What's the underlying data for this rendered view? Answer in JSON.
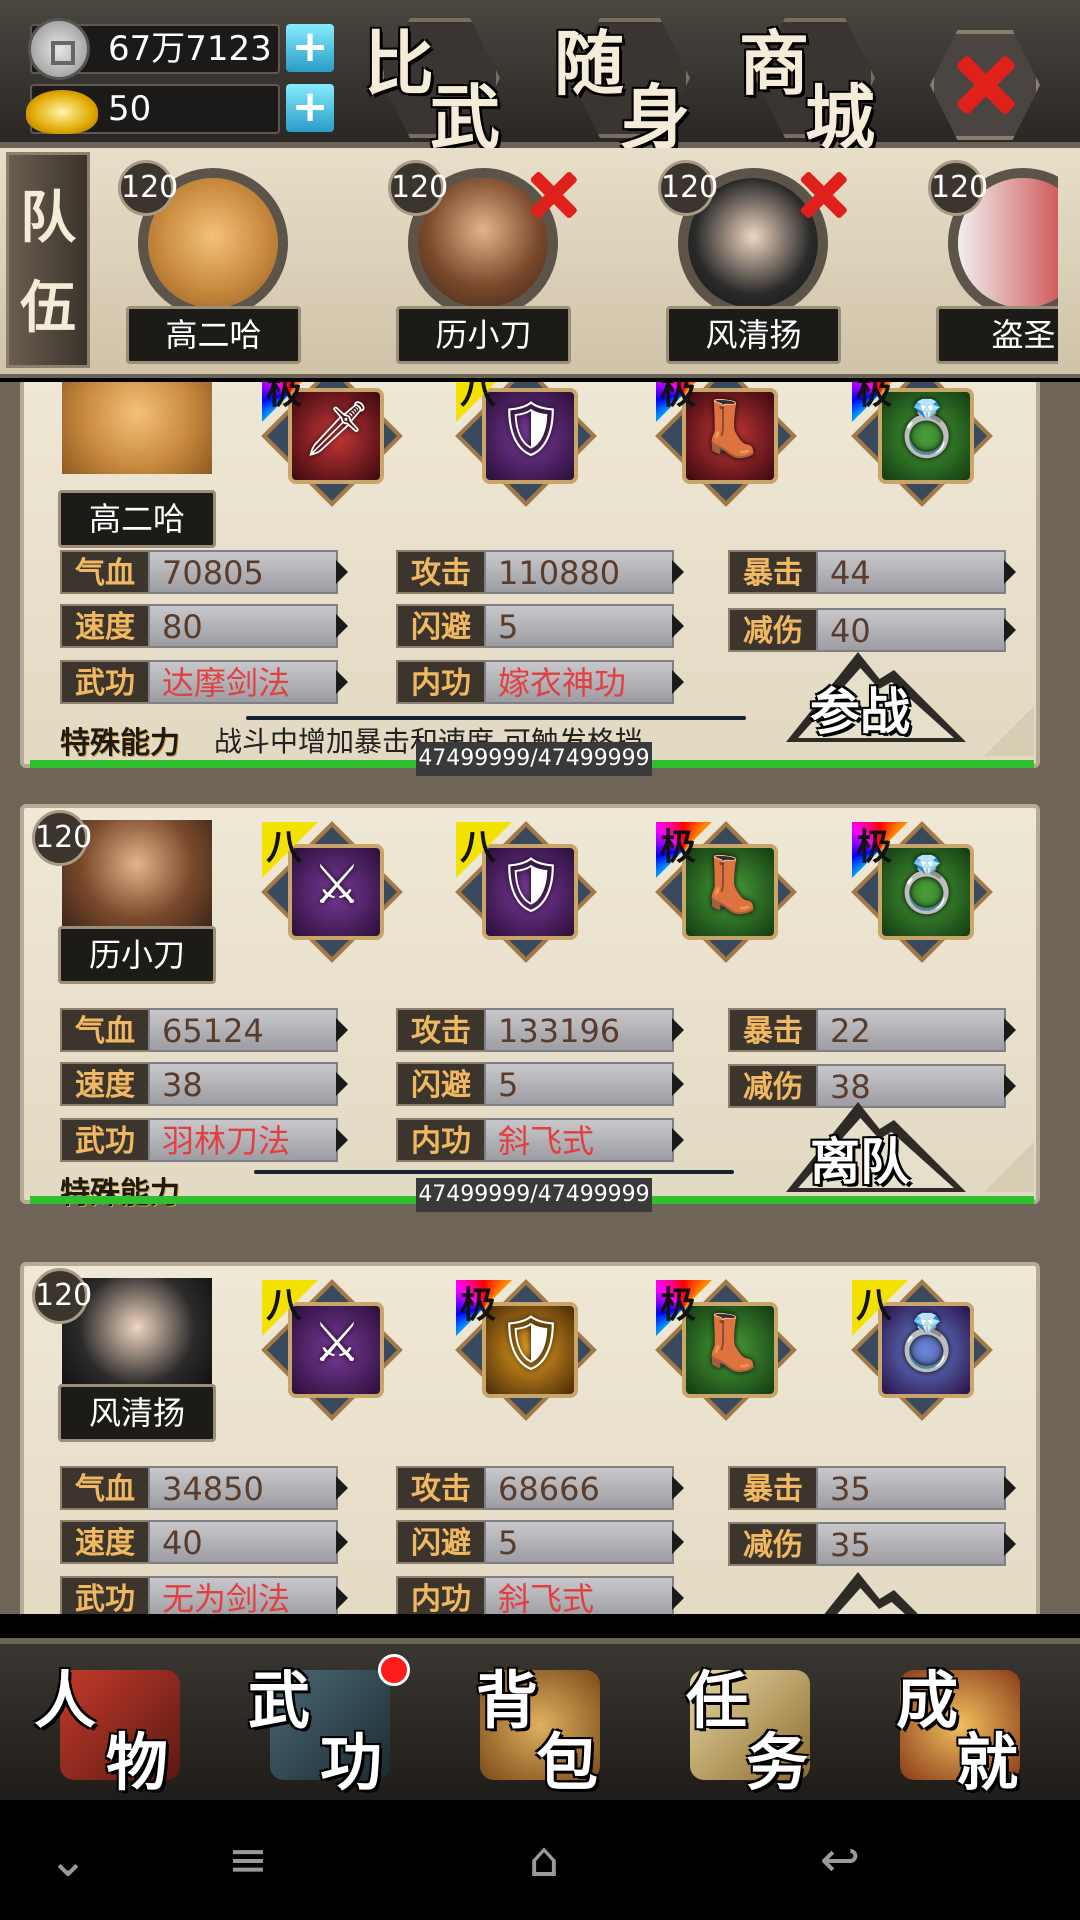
{
  "currency": {
    "silver": "67万7123",
    "gold": "50"
  },
  "top_buttons": [
    {
      "l1": "比",
      "l2": "武"
    },
    {
      "l1": "随",
      "l2": "身"
    },
    {
      "l1": "商",
      "l2": "城"
    }
  ],
  "team": {
    "label": [
      "队",
      "伍"
    ],
    "members": [
      {
        "level": "120",
        "name": "高二哈",
        "removable": false
      },
      {
        "level": "120",
        "name": "历小刀",
        "removable": true
      },
      {
        "level": "120",
        "name": "风清扬",
        "removable": true
      },
      {
        "level": "120",
        "name": "盗圣",
        "removable": false
      }
    ]
  },
  "rank_labels": {
    "ji": "极",
    "ba": "八"
  },
  "cards": [
    {
      "name": "高二哈",
      "level": "",
      "equip": [
        {
          "rank": "极",
          "icon": "🗡"
        },
        {
          "rank": "八",
          "icon": "🛡"
        },
        {
          "rank": "极",
          "icon": "👢"
        },
        {
          "rank": "极",
          "icon": "💍"
        }
      ],
      "stats": [
        {
          "label": "气血",
          "value": "70805"
        },
        {
          "label": "攻击",
          "value": "110880"
        },
        {
          "label": "暴击",
          "value": "44"
        },
        {
          "label": "速度",
          "value": "80"
        },
        {
          "label": "闪避",
          "value": "5"
        },
        {
          "label": "减伤",
          "value": "40"
        },
        {
          "label": "武功",
          "value": "达摩剑法"
        },
        {
          "label": "内功",
          "value": "嫁衣神功"
        }
      ],
      "special_label": "特殊能力",
      "special_desc": "战斗中增加暴击和速度,可触发格挡",
      "action": "参战",
      "hp": "47499999/47499999"
    },
    {
      "name": "历小刀",
      "level": "120",
      "equip": [
        {
          "rank": "八",
          "icon": "⚔"
        },
        {
          "rank": "八",
          "icon": "🛡"
        },
        {
          "rank": "极",
          "icon": "👢"
        },
        {
          "rank": "极",
          "icon": "💍"
        }
      ],
      "stats": [
        {
          "label": "气血",
          "value": "65124"
        },
        {
          "label": "攻击",
          "value": "133196"
        },
        {
          "label": "暴击",
          "value": "22"
        },
        {
          "label": "速度",
          "value": "38"
        },
        {
          "label": "闪避",
          "value": "5"
        },
        {
          "label": "减伤",
          "value": "38"
        },
        {
          "label": "武功",
          "value": "羽林刀法"
        },
        {
          "label": "内功",
          "value": "斜飞式"
        }
      ],
      "special_label": "特殊能力",
      "special_desc": "",
      "action": "离队",
      "hp": "47499999/47499999"
    },
    {
      "name": "风清扬",
      "level": "120",
      "equip": [
        {
          "rank": "八",
          "icon": "⚔"
        },
        {
          "rank": "极",
          "icon": "🛡"
        },
        {
          "rank": "极",
          "icon": "👢"
        },
        {
          "rank": "八",
          "icon": "💍"
        }
      ],
      "stats": [
        {
          "label": "气血",
          "value": "34850"
        },
        {
          "label": "攻击",
          "value": "68666"
        },
        {
          "label": "暴击",
          "value": "35"
        },
        {
          "label": "速度",
          "value": "40"
        },
        {
          "label": "闪避",
          "value": "5"
        },
        {
          "label": "减伤",
          "value": "35"
        },
        {
          "label": "武功",
          "value": "无为剑法"
        },
        {
          "label": "内功",
          "value": "斜飞式"
        }
      ],
      "special_label": "",
      "special_desc": "",
      "action": "",
      "hp": ""
    }
  ],
  "bottom_nav": [
    {
      "l1": "人",
      "l2": "物",
      "badge": false
    },
    {
      "l1": "武",
      "l2": "功",
      "badge": true
    },
    {
      "l1": "背",
      "l2": "包",
      "badge": false
    },
    {
      "l1": "任",
      "l2": "务",
      "badge": false
    },
    {
      "l1": "成",
      "l2": "就",
      "badge": false
    }
  ],
  "system_nav": [
    "⌄",
    "≡",
    "⌂",
    "↩"
  ]
}
